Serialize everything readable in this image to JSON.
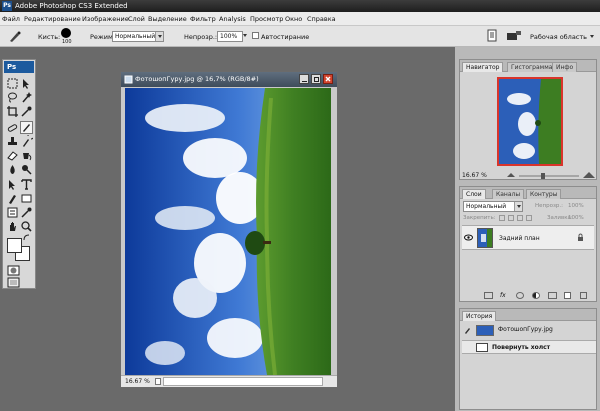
{
  "app": {
    "window_title": "Adobe Photoshop CS3 Extended",
    "logo": "Ps"
  },
  "menu": [
    "Файл",
    "Редактирование",
    "Изображение",
    "Слой",
    "Выделение",
    "Фильтр",
    "Analysis",
    "Просмотр",
    "Окно",
    "Справка"
  ],
  "options": {
    "brush_label": "Кисть:",
    "brush_size": "100",
    "mode_label": "Режим:",
    "mode_value": "Нормальный",
    "opacity_label": "Непрозр.:",
    "opacity_value": "100%",
    "airbrush_label": "Автостирание",
    "workspace_label": "Рабочая область"
  },
  "document": {
    "title": "ФотошопГуру.jpg @ 16,7% (RGB/8#)",
    "zoom": "16.67 %"
  },
  "navigator_panel": {
    "tabs": [
      "Навигатор",
      "Гистограмма",
      "Инфо"
    ],
    "zoom": "16.67 %"
  },
  "layers_panel": {
    "tabs": [
      "Слои",
      "Каналы",
      "Контуры"
    ],
    "blend_mode": "Нормальный",
    "opacity_label": "Непрозр.:",
    "opacity_value": "100%",
    "lock_label": "Закрепить:",
    "fill_label": "Заливка:",
    "fill_value": "100%",
    "layer_name": "Задний план"
  },
  "history_panel": {
    "tabs": [
      "История"
    ],
    "snapshot": "ФотошопГуру.jpg",
    "step": "Повернуть холст"
  },
  "colors": {
    "titlebar": "#2a2a2a",
    "workspace": "#6a6a6a",
    "ps_blue": "#1c5a9e",
    "nav_frame": "#d9342b"
  },
  "icons": [
    "brush-icon",
    "marquee-icon",
    "move-icon",
    "lasso-icon",
    "magic-wand-icon",
    "crop-icon",
    "eyedropper-icon",
    "healing-icon",
    "brush-tool-icon",
    "clone-stamp-icon",
    "history-brush-icon",
    "eraser-icon",
    "gradient-icon",
    "blur-icon",
    "dodge-icon",
    "pen-icon",
    "type-icon",
    "path-select-icon",
    "shape-icon",
    "notes-icon",
    "hand-icon",
    "zoom-icon",
    "eye-icon",
    "lock-icon"
  ]
}
